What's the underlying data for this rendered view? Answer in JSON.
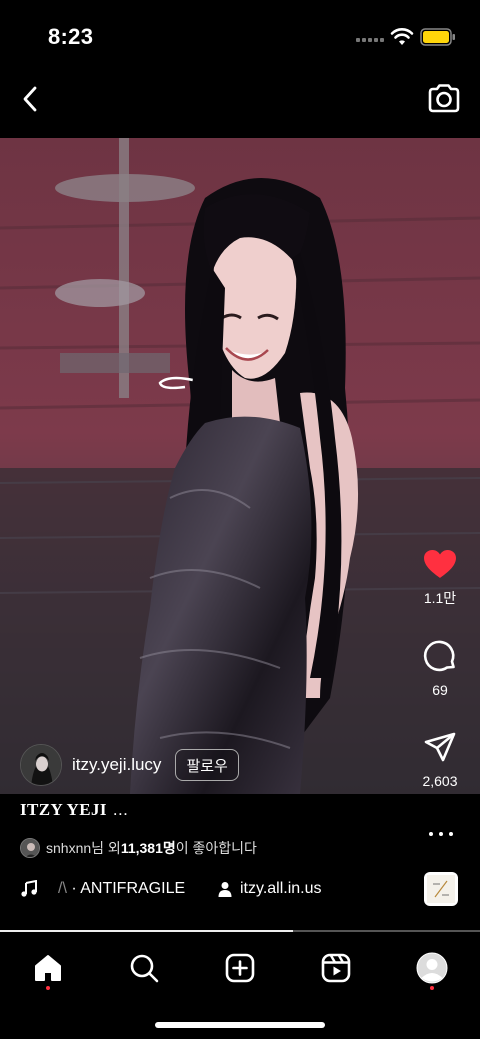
{
  "status_bar": {
    "time": "8:23"
  },
  "top_bar": {
    "back_icon": "chevron-left-icon",
    "camera_icon": "camera-icon"
  },
  "actions": {
    "likes": "1.1만",
    "comments": "69",
    "shares": "2,603",
    "like_color": "#ff3040"
  },
  "post": {
    "username": "itzy.yeji.lucy",
    "follow_label": "팔로우",
    "caption": "ITZY YEJI",
    "caption_more": "..."
  },
  "likes_line": {
    "user": "snhxnn",
    "middle": "님 외 ",
    "count": "11,381명",
    "suffix": "이 좋아합니다"
  },
  "music": {
    "faded_prefix": "/\\",
    "title": " · ANTIFRAGILE",
    "tagged_user": "itzy.all.in.us"
  },
  "playback": {
    "progress_fraction": 0.61
  },
  "bottom_nav": {
    "items": [
      "home-icon",
      "search-icon",
      "create-icon",
      "reels-icon",
      "profile-icon"
    ]
  }
}
